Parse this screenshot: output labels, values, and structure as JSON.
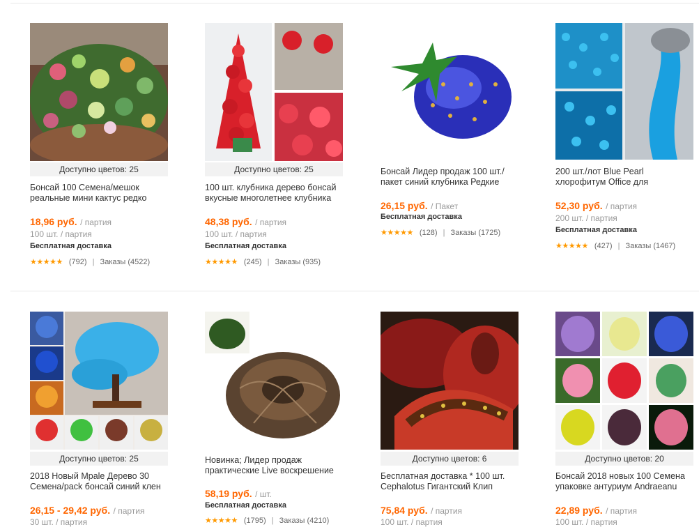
{
  "rating_stars": "★★★★★",
  "products": [
    {
      "colors": "Доступно цветов: 25",
      "title": "Бонсай 100 Семена/мешок реальные мини кактус редко",
      "price": "18,96 руб.",
      "unit": "/ партия",
      "sub": "100 шт. / партия",
      "ship": "Бесплатная доставка",
      "reviews": "(792)",
      "orders": "Заказы (4522)",
      "image": "succulent-bowl"
    },
    {
      "colors": "Доступно цветов: 25",
      "title": "100 шт. клубника дерево бонсай вкусные многолетнее клубника",
      "price": "48,38 руб.",
      "unit": "/ партия",
      "sub": "100 шт. / партия",
      "ship": "Бесплатная доставка",
      "reviews": "(245)",
      "orders": "Заказы (935)",
      "image": "strawberry-tree"
    },
    {
      "colors": "",
      "title": "Бонсай Лидер продаж 100 шт./ пакет синий клубника Редкие",
      "price": "26,15 руб.",
      "unit": "/ Пакет",
      "sub": "",
      "ship": "Бесплатная доставка",
      "reviews": "(128)",
      "orders": "Заказы (1725)",
      "image": "blue-strawberry"
    },
    {
      "colors": "",
      "title": "200 шт./лот Blue Pearl хлорофитум Office для",
      "price": "52,30 руб.",
      "unit": "/ партия",
      "sub": "200 шт. / партия",
      "ship": "Бесплатная доставка",
      "reviews": "(427)",
      "orders": "Заказы (1467)",
      "image": "blue-pearl"
    },
    {
      "colors": "Доступно цветов: 25",
      "title": "2018 Новый Mpale Дерево 30 Семена/pack бонсай синий клен",
      "price": "26,15 - 29,42 руб.",
      "unit": "/ партия",
      "sub": "30 шт. / партия",
      "ship": "",
      "reviews": "",
      "orders": "",
      "image": "maple-bonsai"
    },
    {
      "colors": "",
      "title": "Новинка; Лидер продаж практические Live воскрешение",
      "price": "58,19 руб.",
      "unit": "/ шт.",
      "sub": "",
      "ship": "Бесплатная доставка",
      "reviews": "(1795)",
      "orders": "Заказы (4210)",
      "image": "resurrection-plant"
    },
    {
      "colors": "Доступно цветов: 6",
      "title": "Бесплатная доставка * 100 шт. Cephalotus Гигантский Клип",
      "price": "75,84 руб.",
      "unit": "/ партия",
      "sub": "100 шт. / партия",
      "ship": "",
      "reviews": "",
      "orders": "",
      "image": "venus-flytrap"
    },
    {
      "colors": "Доступно цветов: 20",
      "title": "Бонсай 2018 новых 100 Семена упаковке антуриум Andraeanu",
      "price": "22,89 руб.",
      "unit": "/ партия",
      "sub": "100 шт. / партия",
      "ship": "",
      "reviews": "",
      "orders": "",
      "image": "anthurium-grid"
    }
  ]
}
